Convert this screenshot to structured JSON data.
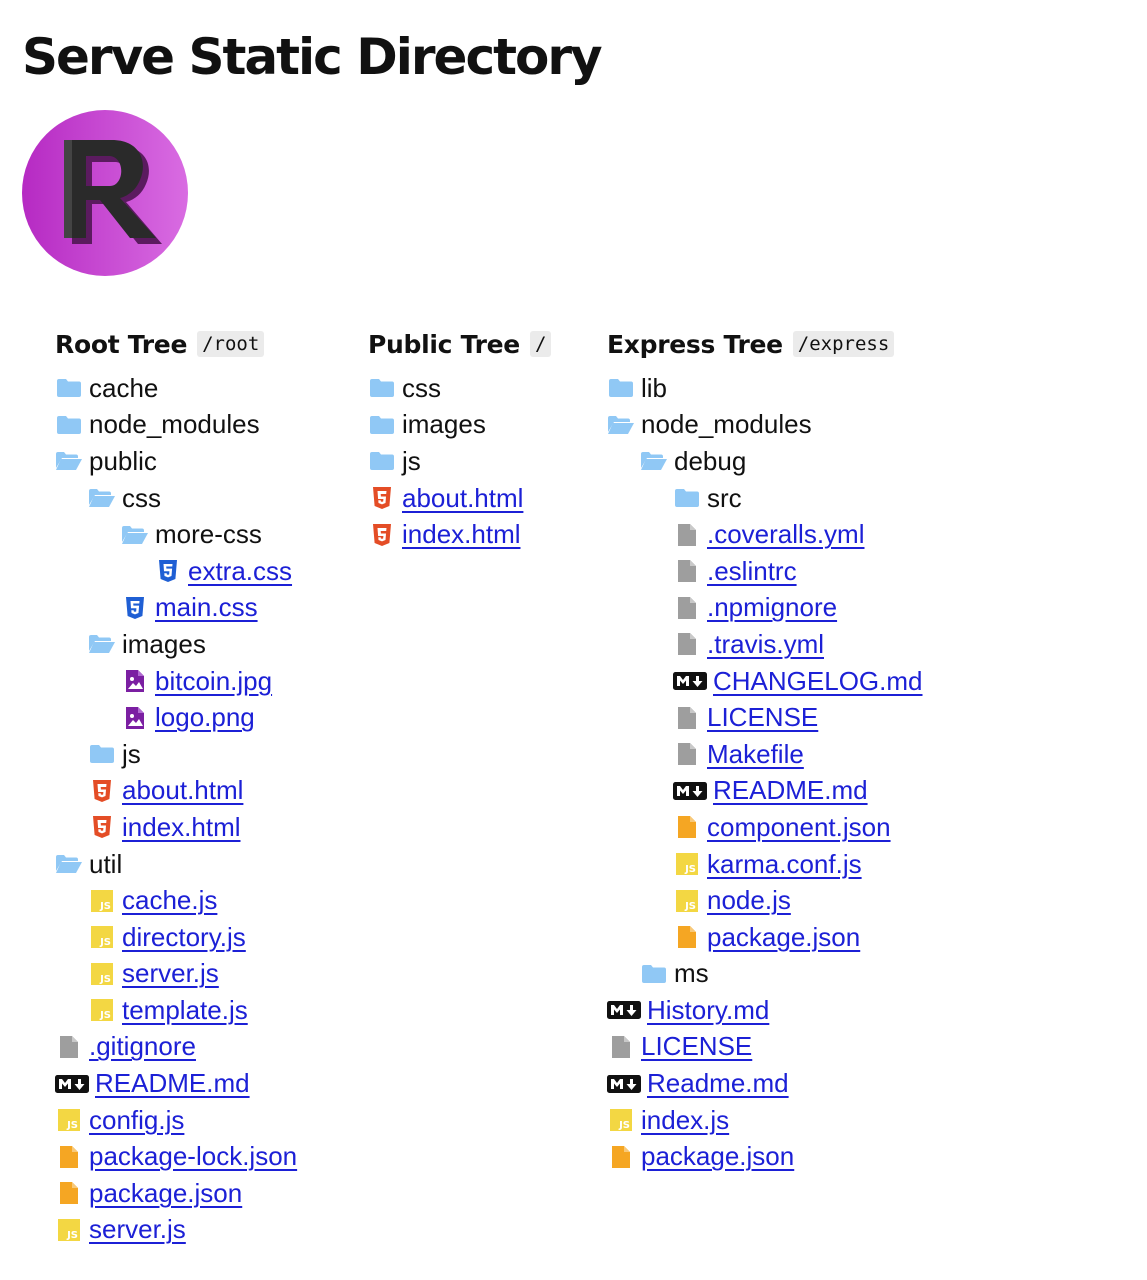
{
  "page": {
    "title": "Serve Static Directory"
  },
  "colors": {
    "link": "#1c20d6",
    "folder": "#90c8f5",
    "html": "#e44d26",
    "css": "#1f5fd4",
    "image": "#7b1fa2",
    "js": "#f3d743",
    "json": "#f5a623",
    "generic_file": "#9e9e9e",
    "logo_gradient": [
      "#b82ec4",
      "#d86be0"
    ]
  },
  "trees": [
    {
      "id": "root",
      "title": "Root Tree",
      "path": "/root",
      "items": [
        {
          "name": "cache",
          "type": "dir",
          "icon": "folder-icon",
          "depth": 0
        },
        {
          "name": "node_modules",
          "type": "dir",
          "icon": "folder-icon",
          "depth": 0
        },
        {
          "name": "public",
          "type": "dir",
          "icon": "folder-open-icon",
          "depth": 0
        },
        {
          "name": "css",
          "type": "dir",
          "icon": "folder-open-icon",
          "depth": 1
        },
        {
          "name": "more-css",
          "type": "dir",
          "icon": "folder-open-icon",
          "depth": 2
        },
        {
          "name": "extra.css",
          "type": "file",
          "icon": "css-file-icon",
          "depth": 3
        },
        {
          "name": "main.css",
          "type": "file",
          "icon": "css-file-icon",
          "depth": 2
        },
        {
          "name": "images",
          "type": "dir",
          "icon": "folder-open-icon",
          "depth": 1
        },
        {
          "name": "bitcoin.jpg",
          "type": "file",
          "icon": "image-file-icon",
          "depth": 2
        },
        {
          "name": "logo.png",
          "type": "file",
          "icon": "image-file-icon",
          "depth": 2
        },
        {
          "name": "js",
          "type": "dir",
          "icon": "folder-icon",
          "depth": 1
        },
        {
          "name": "about.html",
          "type": "file",
          "icon": "html-file-icon",
          "depth": 1
        },
        {
          "name": "index.html",
          "type": "file",
          "icon": "html-file-icon",
          "depth": 1
        },
        {
          "name": "util",
          "type": "dir",
          "icon": "folder-open-icon",
          "depth": 0
        },
        {
          "name": "cache.js",
          "type": "file",
          "icon": "js-file-icon",
          "depth": 1
        },
        {
          "name": "directory.js",
          "type": "file",
          "icon": "js-file-icon",
          "depth": 1
        },
        {
          "name": "server.js",
          "type": "file",
          "icon": "js-file-icon",
          "depth": 1
        },
        {
          "name": "template.js",
          "type": "file",
          "icon": "js-file-icon",
          "depth": 1
        },
        {
          "name": ".gitignore",
          "type": "file",
          "icon": "generic-file-icon",
          "depth": 0
        },
        {
          "name": "README.md",
          "type": "file",
          "icon": "markdown-file-icon",
          "depth": 0
        },
        {
          "name": "config.js",
          "type": "file",
          "icon": "js-file-icon",
          "depth": 0
        },
        {
          "name": "package-lock.json",
          "type": "file",
          "icon": "json-file-icon",
          "depth": 0
        },
        {
          "name": "package.json",
          "type": "file",
          "icon": "json-file-icon",
          "depth": 0
        },
        {
          "name": "server.js",
          "type": "file",
          "icon": "js-file-icon",
          "depth": 0
        }
      ]
    },
    {
      "id": "public",
      "title": "Public Tree",
      "path": "/",
      "items": [
        {
          "name": "css",
          "type": "dir",
          "icon": "folder-icon",
          "depth": 0
        },
        {
          "name": "images",
          "type": "dir",
          "icon": "folder-icon",
          "depth": 0
        },
        {
          "name": "js",
          "type": "dir",
          "icon": "folder-icon",
          "depth": 0
        },
        {
          "name": "about.html",
          "type": "file",
          "icon": "html-file-icon",
          "depth": 0
        },
        {
          "name": "index.html",
          "type": "file",
          "icon": "html-file-icon",
          "depth": 0
        }
      ]
    },
    {
      "id": "express",
      "title": "Express Tree",
      "path": "/express",
      "items": [
        {
          "name": "lib",
          "type": "dir",
          "icon": "folder-icon",
          "depth": 0
        },
        {
          "name": "node_modules",
          "type": "dir",
          "icon": "folder-open-icon",
          "depth": 0
        },
        {
          "name": "debug",
          "type": "dir",
          "icon": "folder-open-icon",
          "depth": 1
        },
        {
          "name": "src",
          "type": "dir",
          "icon": "folder-icon",
          "depth": 2
        },
        {
          "name": ".coveralls.yml",
          "type": "file",
          "icon": "generic-file-icon",
          "depth": 2
        },
        {
          "name": ".eslintrc",
          "type": "file",
          "icon": "generic-file-icon",
          "depth": 2
        },
        {
          "name": ".npmignore",
          "type": "file",
          "icon": "generic-file-icon",
          "depth": 2
        },
        {
          "name": ".travis.yml",
          "type": "file",
          "icon": "generic-file-icon",
          "depth": 2
        },
        {
          "name": "CHANGELOG.md",
          "type": "file",
          "icon": "markdown-file-icon",
          "depth": 2
        },
        {
          "name": "LICENSE",
          "type": "file",
          "icon": "generic-file-icon",
          "depth": 2
        },
        {
          "name": "Makefile",
          "type": "file",
          "icon": "generic-file-icon",
          "depth": 2
        },
        {
          "name": "README.md",
          "type": "file",
          "icon": "markdown-file-icon",
          "depth": 2
        },
        {
          "name": "component.json",
          "type": "file",
          "icon": "json-file-icon",
          "depth": 2
        },
        {
          "name": "karma.conf.js",
          "type": "file",
          "icon": "js-file-icon",
          "depth": 2
        },
        {
          "name": "node.js",
          "type": "file",
          "icon": "js-file-icon",
          "depth": 2
        },
        {
          "name": "package.json",
          "type": "file",
          "icon": "json-file-icon",
          "depth": 2
        },
        {
          "name": "ms",
          "type": "dir",
          "icon": "folder-icon",
          "depth": 1
        },
        {
          "name": "History.md",
          "type": "file",
          "icon": "markdown-file-icon",
          "depth": 0
        },
        {
          "name": "LICENSE",
          "type": "file",
          "icon": "generic-file-icon",
          "depth": 0
        },
        {
          "name": "Readme.md",
          "type": "file",
          "icon": "markdown-file-icon",
          "depth": 0
        },
        {
          "name": "index.js",
          "type": "file",
          "icon": "js-file-icon",
          "depth": 0
        },
        {
          "name": "package.json",
          "type": "file",
          "icon": "json-file-icon",
          "depth": 0
        }
      ]
    }
  ]
}
